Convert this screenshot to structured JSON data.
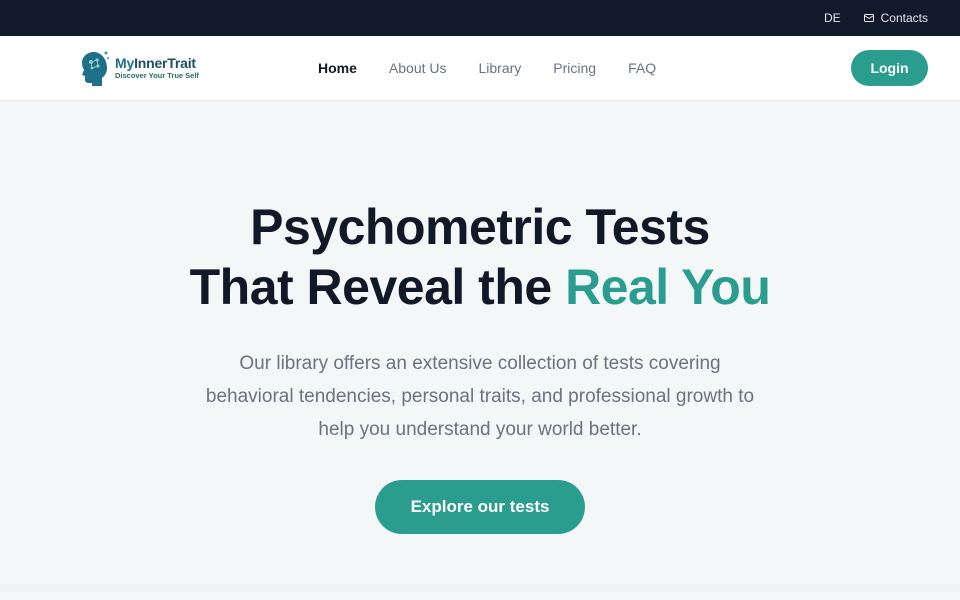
{
  "topbar": {
    "language": "DE",
    "contacts_label": "Contacts",
    "contacts_icon": "mail-icon"
  },
  "brand": {
    "name_part1": "My",
    "name_part2": "InnerTrait",
    "tagline": "Discover Your True Self",
    "logo_icon": "head-profile-icon"
  },
  "nav": {
    "items": [
      {
        "label": "Home",
        "active": true
      },
      {
        "label": "About Us"
      },
      {
        "label": "Library"
      },
      {
        "label": "Pricing"
      },
      {
        "label": "FAQ"
      }
    ],
    "login_label": "Login"
  },
  "hero": {
    "title_line1": "Psychometric Tests",
    "title_line2_prefix": "That Reveal the ",
    "title_line2_accent": "Real You",
    "description": "Our library offers an extensive collection of tests covering behavioral tendencies, personal traits, and professional growth to help you understand your world better.",
    "cta_label": "Explore our tests"
  },
  "colors": {
    "topbar_bg": "#111a2b",
    "accent": "#2a9d8f",
    "hero_bg": "#f3f7f8"
  }
}
